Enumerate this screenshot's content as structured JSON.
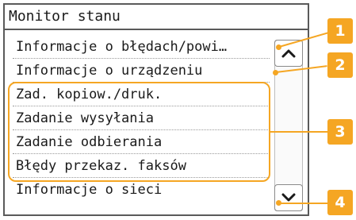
{
  "screen": {
    "title": "Monitor stanu",
    "items": [
      {
        "label": "Informacje o błędach/powi…"
      },
      {
        "label": "Informacje o urządzeniu"
      },
      {
        "label": "Zad. kopiow./druk."
      },
      {
        "label": "Zadanie wysyłania"
      },
      {
        "label": "Zadanie odbierania"
      },
      {
        "label": "Błędy przekaz. faksów"
      },
      {
        "label": "Informacje o sieci"
      }
    ]
  },
  "callouts": [
    "1",
    "2",
    "3",
    "4"
  ],
  "colors": {
    "accent": "#f5a623",
    "border": "#5a5a5a",
    "text": "#1a1a1a"
  },
  "icons": {
    "scroll_up": "chevron-up-icon",
    "scroll_down": "chevron-down-icon"
  }
}
